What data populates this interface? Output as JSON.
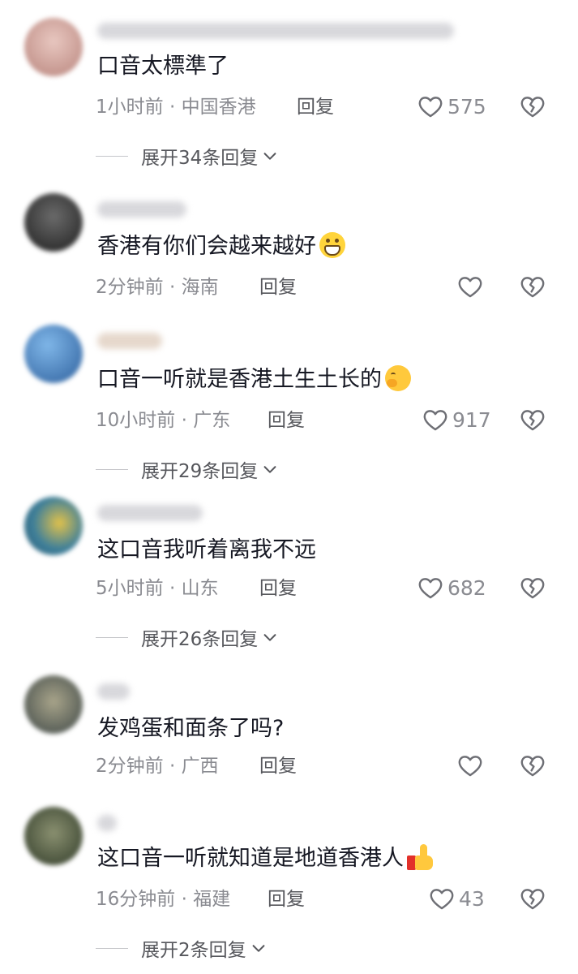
{
  "comments": [
    {
      "text": "口音太標準了",
      "emoji": "",
      "meta": "1小时前 · 中国香港",
      "reply_label": "回复",
      "likes": "575",
      "expand_label": "展开34条回复",
      "avatar_color": "#c9a09a"
    },
    {
      "text": "香港有你们会越来越好",
      "emoji": "grin",
      "meta": "2分钟前 · 海南",
      "reply_label": "回复",
      "likes": "",
      "expand_label": "",
      "avatar_color": "#3a3a3a"
    },
    {
      "text": "口音一听就是香港土生土长的",
      "emoji": "smirk",
      "meta": "10小时前 · 广东",
      "reply_label": "回复",
      "likes": "917",
      "expand_label": "展开29条回复",
      "avatar_color": "#3f7fc8"
    },
    {
      "text": "这口音我听着离我不远",
      "emoji": "",
      "meta": "5小时前 · 山东",
      "reply_label": "回复",
      "likes": "682",
      "expand_label": "展开26条回复",
      "avatar_color": "#4f8fa8"
    },
    {
      "text": "发鸡蛋和面条了吗?",
      "emoji": "",
      "meta": "2分钟前 · 广西",
      "reply_label": "回复",
      "likes": "",
      "expand_label": "",
      "avatar_color": "#5a6a6a"
    },
    {
      "text": "这口音一听就知道是地道香港人",
      "emoji": "thumbs-up",
      "meta": "16分钟前 · 福建",
      "reply_label": "回复",
      "likes": "43",
      "expand_label": "展开2条回复",
      "avatar_color": "#4a5a40"
    }
  ],
  "icons": {
    "like": "heart-outline-icon",
    "dislike": "broken-heart-icon",
    "expand": "chevron-down-icon"
  },
  "colors": {
    "text": "#161823",
    "meta": "#8a8b91",
    "reply": "#56575c"
  }
}
